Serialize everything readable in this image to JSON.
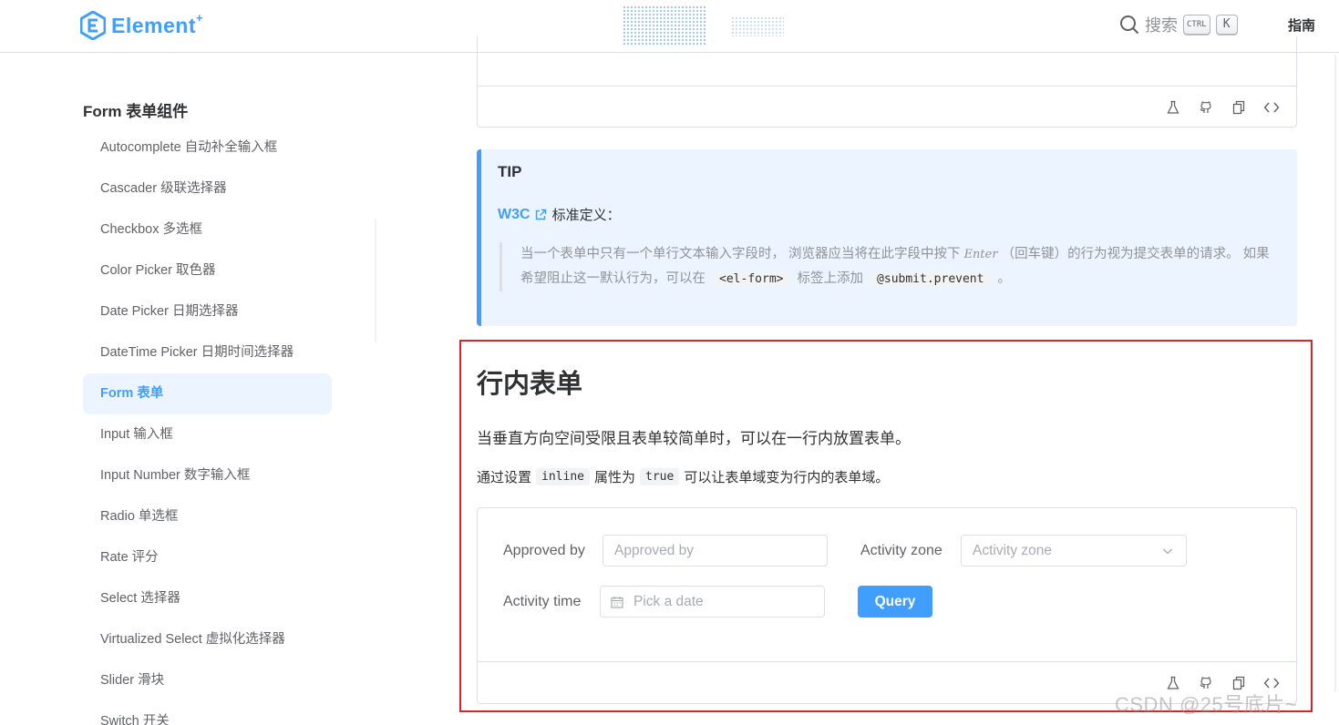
{
  "header": {
    "logo_text": "Element",
    "logo_plus": "+",
    "search_label": "搜索",
    "search_key_ctrl": "CTRL",
    "search_key_k": "K",
    "guide_label": "指南"
  },
  "sidebar": {
    "group_title": "Form 表单组件",
    "items": [
      {
        "label": "Autocomplete 自动补全输入框"
      },
      {
        "label": "Cascader 级联选择器"
      },
      {
        "label": "Checkbox 多选框"
      },
      {
        "label": "Color Picker 取色器"
      },
      {
        "label": "Date Picker 日期选择器"
      },
      {
        "label": "DateTime Picker 日期时间选择器"
      },
      {
        "label": "Form 表单",
        "active": true
      },
      {
        "label": "Input 输入框"
      },
      {
        "label": "Input Number 数字输入框"
      },
      {
        "label": "Radio 单选框"
      },
      {
        "label": "Rate 评分"
      },
      {
        "label": "Select 选择器"
      },
      {
        "label": "Virtualized Select 虚拟化选择器"
      },
      {
        "label": "Slider 滑块"
      },
      {
        "label": "Switch 开关"
      }
    ]
  },
  "tip": {
    "title": "TIP",
    "link_text": "W3C",
    "after_link": "标准定义：",
    "quote_part1": "当一个表单中只有一个单行文本输入字段时， 浏览器应当将在此字段中按下",
    "quote_key": "Enter",
    "quote_part2": "（回车键）的行为视为提交表单的请求。 如果希望阻止这一默认行为，可以在",
    "quote_code1": "<el-form>",
    "quote_part3": "标签上添加",
    "quote_code2": "@submit.prevent",
    "quote_part4": "。"
  },
  "section": {
    "title": "行内表单",
    "description": "当垂直方向空间受限且表单较简单时，可以在一行内放置表单。",
    "desc2_part1": "通过设置",
    "desc2_code1": "inline",
    "desc2_part2": "属性为",
    "desc2_code2": "true",
    "desc2_part3": "可以让表单域变为行内的表单域。"
  },
  "form": {
    "approved_label": "Approved by",
    "approved_placeholder": "Approved by",
    "zone_label": "Activity zone",
    "zone_placeholder": "Activity zone",
    "time_label": "Activity time",
    "time_placeholder": "Pick a date",
    "query_button": "Query"
  },
  "toolbar_icons": [
    "flask-icon",
    "github-icon",
    "copy-icon",
    "code-icon"
  ],
  "watermark": "CSDN @25号底片~",
  "colors": {
    "primary": "#409eff",
    "highlight_border": "#d9232b",
    "tip_background": "#ecf5ff"
  }
}
